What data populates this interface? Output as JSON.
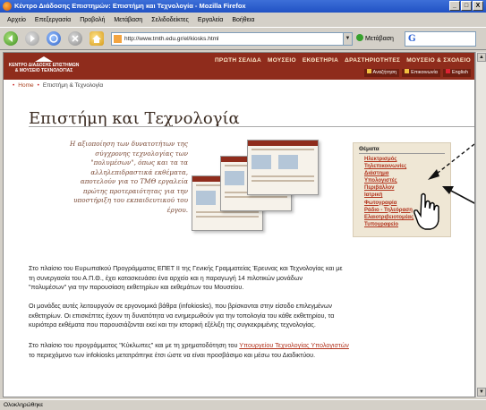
{
  "window": {
    "title": "Κέντρο Διάδοσης Επιστημών: Επιστήμη και Τεχνολογία - Mozilla Firefox",
    "controls": [
      "_",
      "□",
      "X"
    ]
  },
  "menubar": [
    "Αρχείο",
    "Επεξεργασία",
    "Προβολή",
    "Μετάβαση",
    "Σελιδοδείκτες",
    "Εργαλεία",
    "Βοήθεια"
  ],
  "toolbar": {
    "url": "http://www.tmth.edu.gr/el/kiosks.html",
    "go_label": "Μετάβαση",
    "search_logo": "G"
  },
  "site": {
    "logo_lines": [
      "ΚΕΝΤΡΟ ΔΙΑΔΟΣΗΣ ΕΠΙΣΤΗΜΩΝ",
      "& ΜΟΥΣΕΙΟ ΤΕΧΝΟΛΟΓΙΑΣ"
    ],
    "nav": [
      "ΠΡΩΤΗ ΣΕΛΙΔΑ",
      "ΜΟΥΣΕΙΟ",
      "ΕΚΘΕΤΗΡΙΑ",
      "ΔΡΑΣΤΗΡΙΟΤΗΤΕΣ",
      "ΜΟΥΣΕΙΟ & ΣΧΟΛΕΙΟ"
    ],
    "tools": [
      "Αναζήτηση",
      "Επικοινωνία",
      "English"
    ]
  },
  "breadcrumb": [
    "Home",
    "Επιστήμη & Τεχνολογία"
  ],
  "page_title": "Επιστήμη και Τεχνολογία",
  "intro_lines": [
    "Η αξιοποίηση των δυνατοτήτων της",
    "σύγχρονης τεχνολογίας των",
    "\"πολυμέσων\", όπως και τα τα",
    "αλληλεπιδραστικά εκθέματα,",
    "αποτελούν για το ΤΜΘ εργαλεία",
    "πρώτης προτεραιότητας για την",
    "υποστήριξη του εκπαιδευτικού του",
    "έργου."
  ],
  "topics": {
    "title": "Θέματα",
    "items": [
      "Ηλεκτρισμός",
      "Τηλεπικοινωνίες",
      "Διάστημα",
      "Υπολογιστές",
      "Περιβάλλον",
      "Ιατρική",
      "Φωτογραφία",
      "Ράδιο - Τηλεόραση",
      "Ελαιοτριβειοτομέας",
      "Τυπογραφείο"
    ]
  },
  "paragraphs": [
    {
      "lines": [
        "Στο πλαίσιο του Ευρωπαϊκού Προγράμματος ΕΠΕΤ ΙΙ της Γενικής Γραμματείας Έρευνας και Τεχνολογίας και με",
        "τη συνεργασία του Α.Π.Θ., έχει κατασκευάσει ένα αρχείο και η παραγωγή 14 πιλοτικών μονάδων",
        "\"πολυμέσων\" για την παρουσίαση εκθετηρίων και εκθεμάτων του Μουσείου."
      ]
    },
    {
      "lines": [
        "Οι μονάδες αυτές λειτουργούν σε εργονομικά βάθρα (infokiosks), που βρίσκονται στην είσοδο επιλεγμένων",
        "εκθετηρίων. Οι επισκέπτες έχουν τη δυνατότητα να ενημερωθούν για την τοπολογία του κάθε εκθετηρίου, τα",
        "κυριότερα εκθέματα που παρουσιάζονται εκεί και την ιστορική εξέλιξη της συγκεκριμένης τεχνολογίας."
      ]
    },
    {
      "line1_before": "Στο πλαίσιο του προγράμματος \"Κύκλωπες\" και με τη χρηματοδότηση του",
      "line1_link": "Υπουργείου Τεχνολογίας Υπολογιστών",
      "line2": "το περιεχόμενο των infokiosks μετατράπηκε έτσι ώστε να είναι προσβάσιμο και μέσω του Διαδικτύου."
    }
  ],
  "statusbar": "Ολοκληρώθηκε",
  "colors": {
    "header_bg": "#8f2c1c",
    "link": "#b2341e",
    "intro_text": "#7b4a36",
    "topics_bg": "#efe7d5"
  }
}
